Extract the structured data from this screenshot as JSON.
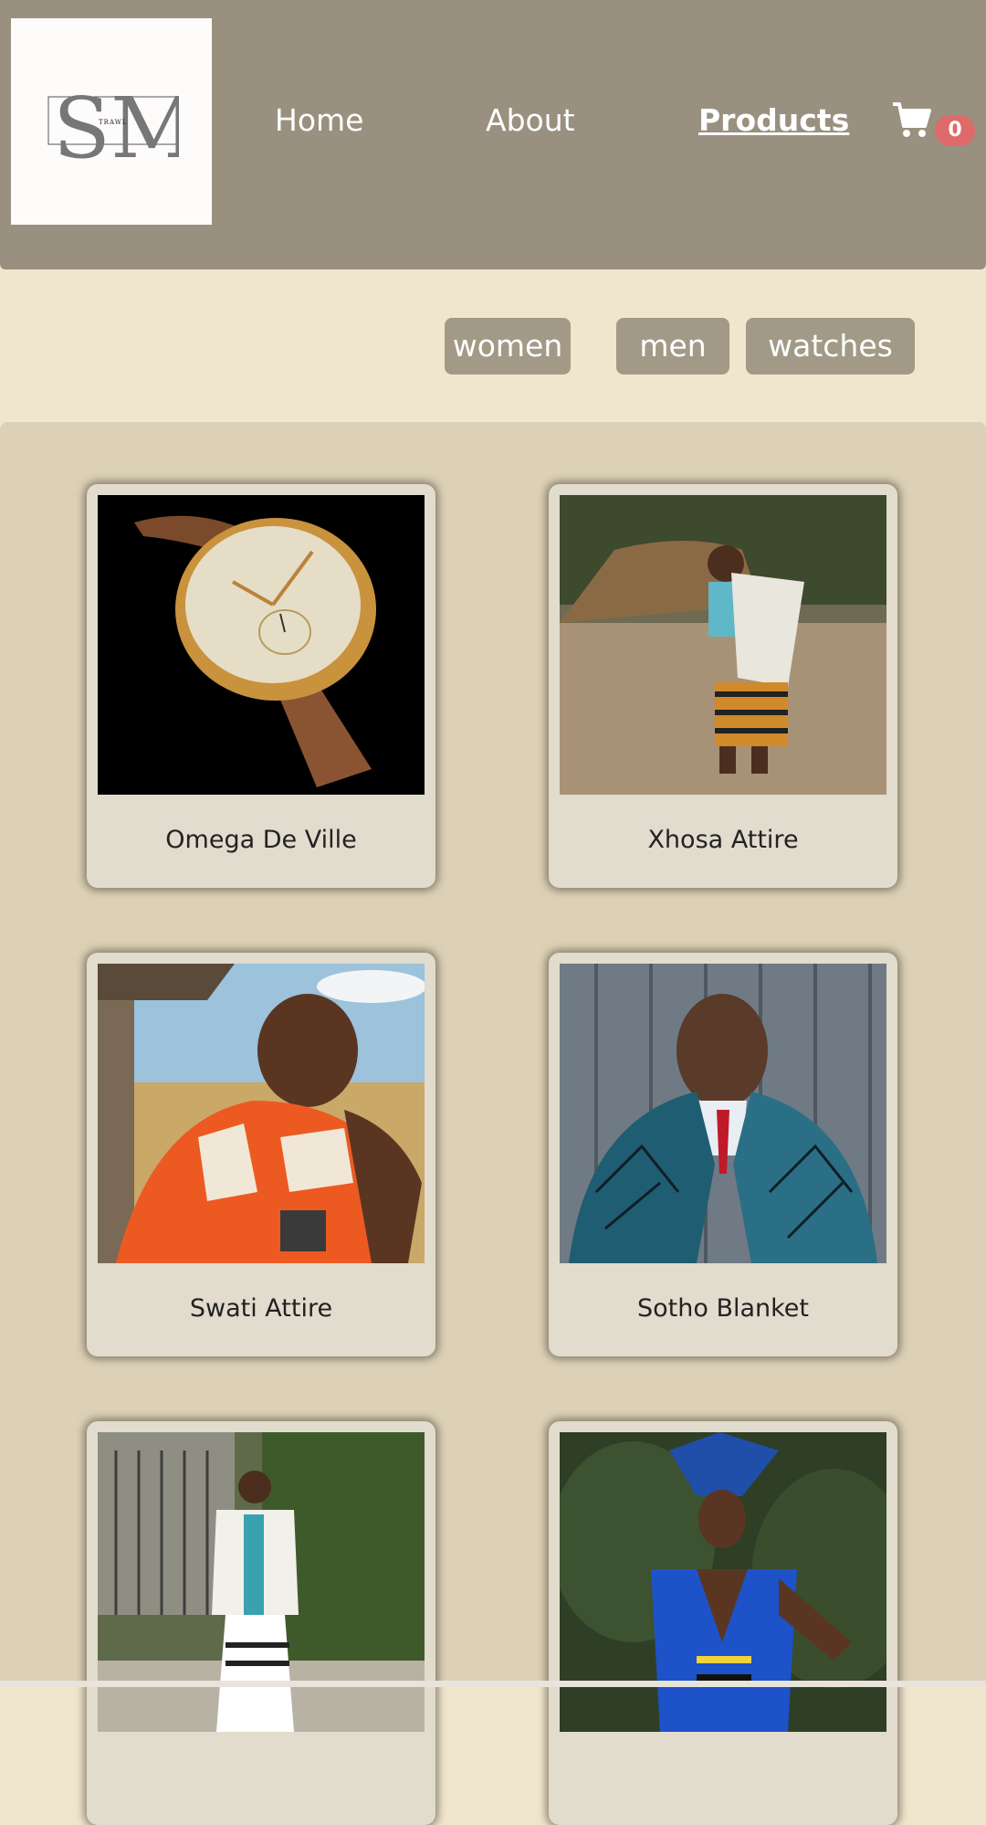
{
  "brand": {
    "logo_letters": "SM",
    "logo_subtext": "TRAWL"
  },
  "nav": {
    "items": [
      {
        "label": "Home",
        "active": false
      },
      {
        "label": "About",
        "active": false
      },
      {
        "label": "Products",
        "active": true
      }
    ],
    "cart_icon": "shopping-cart-icon",
    "cart_count": "0"
  },
  "filters": [
    "women",
    "men",
    "watches"
  ],
  "products": [
    {
      "name": "Omega De Ville",
      "image": "gold-wristwatch-photo"
    },
    {
      "name": "Xhosa Attire",
      "image": "man-in-xhosa-attire-photo"
    },
    {
      "name": "Swati Attire",
      "image": "man-in-swati-attire-photo"
    },
    {
      "name": "Sotho Blanket",
      "image": "man-in-sotho-blanket-photo"
    },
    {
      "name": "",
      "image": "man-in-white-attire-photo"
    },
    {
      "name": "",
      "image": "woman-in-blue-dress-photo"
    }
  ],
  "colors": {
    "header": "#99907f",
    "page_background": "#f0e6cd",
    "panel_background": "#dcd1b6",
    "card_background": "#e1dccd",
    "filter_button": "#a29a87",
    "cart_badge": "#e06a6a"
  }
}
